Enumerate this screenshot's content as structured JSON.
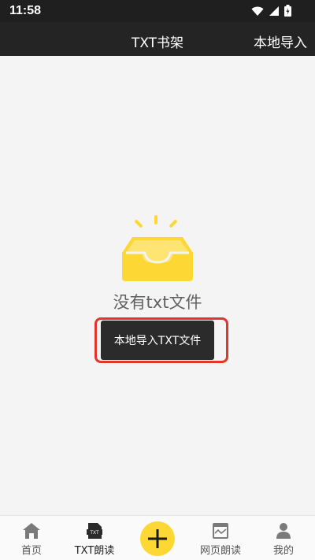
{
  "status_bar": {
    "time": "11:58"
  },
  "header": {
    "title": "TXT书架",
    "action_label": "本地导入"
  },
  "empty_state": {
    "message": "没有txt文件",
    "import_button_label": "本地导入TXT文件"
  },
  "tab_bar": {
    "items": [
      {
        "label": "首页",
        "icon": "home-icon"
      },
      {
        "label": "TXT朗读",
        "icon": "txt-file-icon",
        "active": true
      },
      {
        "label": "",
        "icon": "plus-icon"
      },
      {
        "label": "网页朗读",
        "icon": "webpage-icon"
      },
      {
        "label": "我的",
        "icon": "user-icon"
      }
    ]
  },
  "colors": {
    "accent_yellow": "#fdd835",
    "header_bg": "#242424",
    "highlight_border": "#e0362c"
  }
}
